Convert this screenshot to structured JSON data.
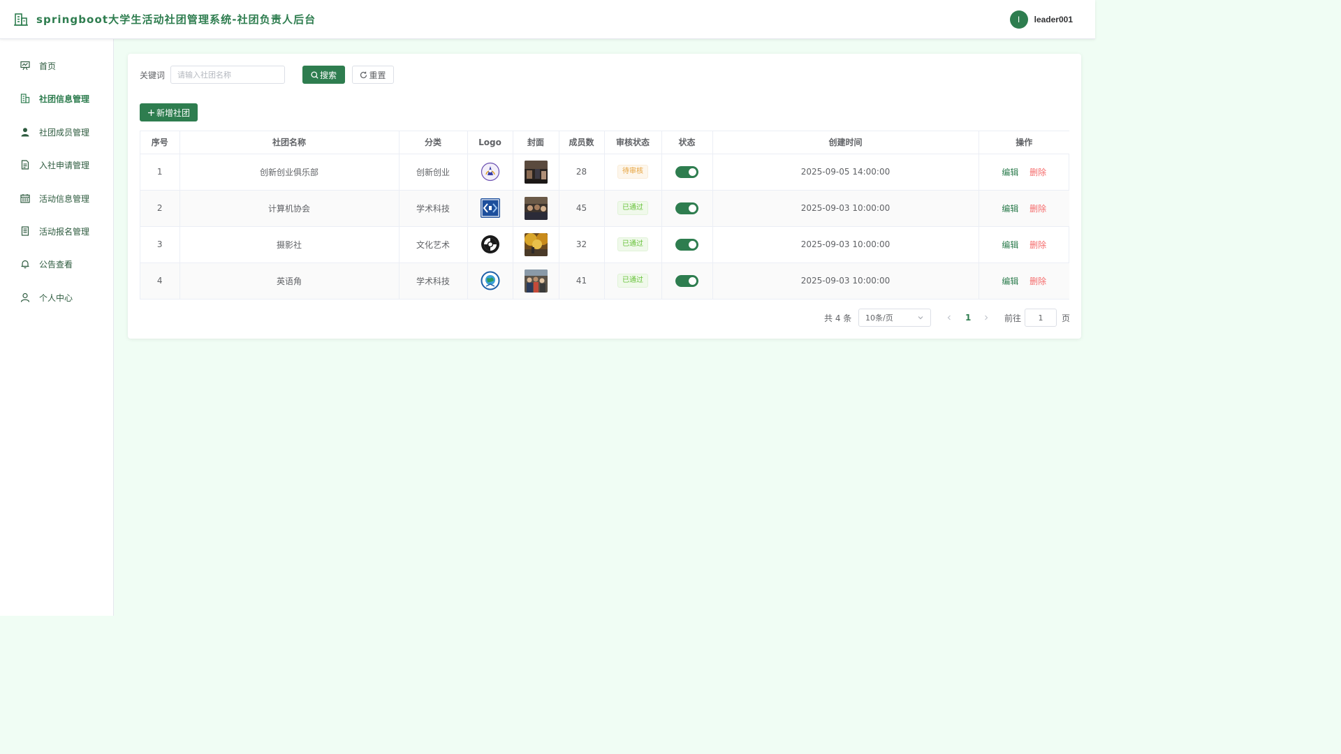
{
  "header": {
    "title": "springboot大学生活动社团管理系统-社团负责人后台",
    "avatar_initial": "l",
    "username": "leader001"
  },
  "sidebar": {
    "items": [
      {
        "label": "首页",
        "icon": "dashboard-icon",
        "active": false
      },
      {
        "label": "社团信息管理",
        "icon": "building-icon",
        "active": true
      },
      {
        "label": "社团成员管理",
        "icon": "user-icon",
        "active": false
      },
      {
        "label": "入社申请管理",
        "icon": "document-icon",
        "active": false
      },
      {
        "label": "活动信息管理",
        "icon": "calendar-icon",
        "active": false
      },
      {
        "label": "活动报名管理",
        "icon": "tickets-icon",
        "active": false
      },
      {
        "label": "公告查看",
        "icon": "bell-icon",
        "active": false
      },
      {
        "label": "个人中心",
        "icon": "person-icon",
        "active": false
      }
    ]
  },
  "search": {
    "label": "关键词",
    "placeholder": "请输入社团名称",
    "value": "",
    "search_label": "搜索",
    "reset_label": "重置"
  },
  "toolbar": {
    "add_label": "新增社团"
  },
  "table": {
    "columns": [
      "序号",
      "社团名称",
      "分类",
      "Logo",
      "封面",
      "成员数",
      "审核状态",
      "状态",
      "创建时间",
      "操作"
    ],
    "rows": [
      {
        "index": "1",
        "name": "创新创业俱乐部",
        "category": "创新创业",
        "members": "28",
        "review": "待审核",
        "review_type": "pending",
        "enabled": true,
        "created": "2025-09-05 14:00:00",
        "edit": "编辑",
        "delete": "删除"
      },
      {
        "index": "2",
        "name": "计算机协会",
        "category": "学术科技",
        "members": "45",
        "review": "已通过",
        "review_type": "pass",
        "enabled": true,
        "created": "2025-09-03 10:00:00",
        "edit": "编辑",
        "delete": "删除"
      },
      {
        "index": "3",
        "name": "摄影社",
        "category": "文化艺术",
        "members": "32",
        "review": "已通过",
        "review_type": "pass",
        "enabled": true,
        "created": "2025-09-03 10:00:00",
        "edit": "编辑",
        "delete": "删除"
      },
      {
        "index": "4",
        "name": "英语角",
        "category": "学术科技",
        "members": "41",
        "review": "已通过",
        "review_type": "pass",
        "enabled": true,
        "created": "2025-09-03 10:00:00",
        "edit": "编辑",
        "delete": "删除"
      }
    ]
  },
  "pagination": {
    "total_text": "共 4 条",
    "page_size": "10条/页",
    "current_page": "1",
    "goto_label": "前往",
    "goto_value": "1",
    "page_suffix": "页"
  },
  "colors": {
    "primary": "#2e7d4f",
    "page_background": "#f0fdf4",
    "danger": "#f56c6c",
    "warning": "#e6a23c",
    "success": "#67c23a"
  }
}
